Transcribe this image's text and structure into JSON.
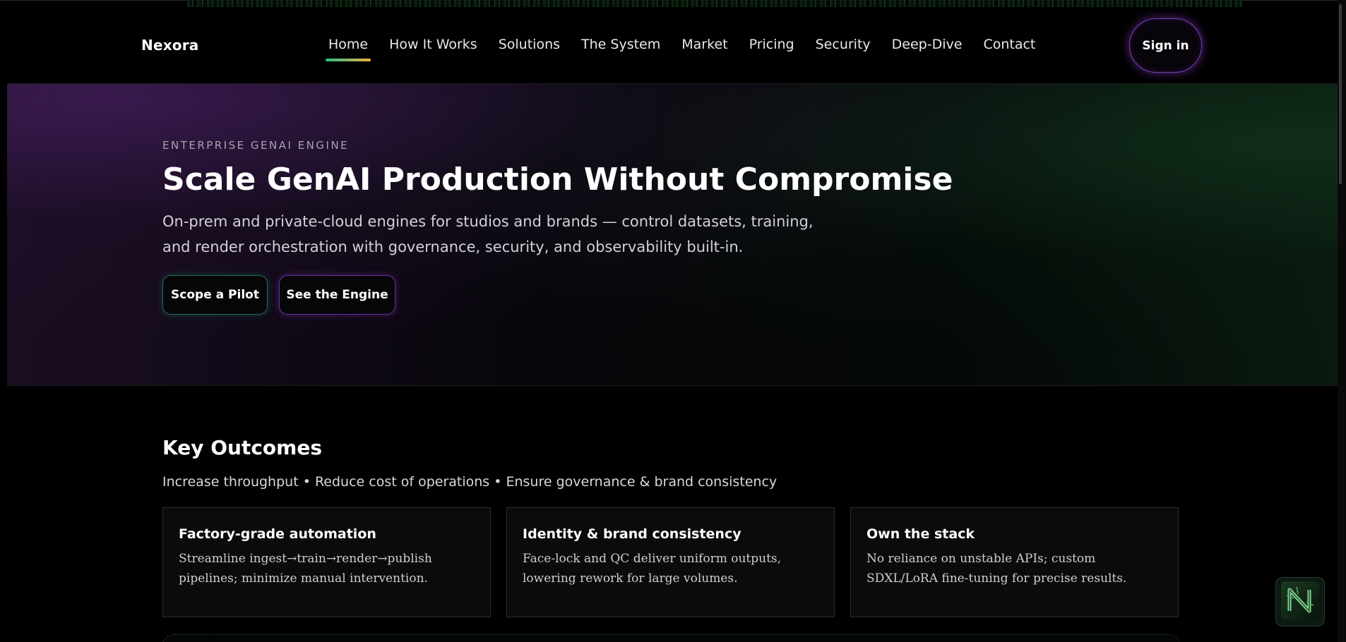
{
  "brand": {
    "name": "Nexora"
  },
  "nav": {
    "items": [
      {
        "label": "Home",
        "active": true
      },
      {
        "label": "How It Works"
      },
      {
        "label": "Solutions"
      },
      {
        "label": "The System"
      },
      {
        "label": "Market"
      },
      {
        "label": "Pricing"
      },
      {
        "label": "Security"
      },
      {
        "label": "Deep-Dive"
      },
      {
        "label": "Contact"
      }
    ],
    "signin_label": "Sign in"
  },
  "hero": {
    "eyebrow": "ENTERPRISE GENAI ENGINE",
    "title": "Scale GenAI Production Without Compromise",
    "subtitle": "On-prem and private-cloud engines for studios and brands — control datasets, training, and render orchestration with governance, security, and observability built-in.",
    "primary_cta": "Scope a Pilot",
    "secondary_cta": "See the Engine"
  },
  "outcomes": {
    "title": "Key Outcomes",
    "subtitle": "Increase throughput • Reduce cost of operations • Ensure governance & brand consistency",
    "cards": [
      {
        "title": "Factory-grade automation",
        "body": "Streamline ingest→train→render→publish pipelines; minimize manual intervention."
      },
      {
        "title": "Identity & brand consistency",
        "body": "Face-lock and QC deliver uniform outputs, lowering rework for large volumes."
      },
      {
        "title": "Own the stack",
        "body": "No reliance on unstable APIs; custom SDXL/LoRA fine-tuning for precise results."
      }
    ]
  },
  "floating_button": {
    "icon": "nexora-logo-icon"
  },
  "colors": {
    "background": "#000000",
    "accent_purple": "#7a3fb1",
    "accent_green": "#27c08b",
    "accent_gold": "#f0b43c"
  }
}
